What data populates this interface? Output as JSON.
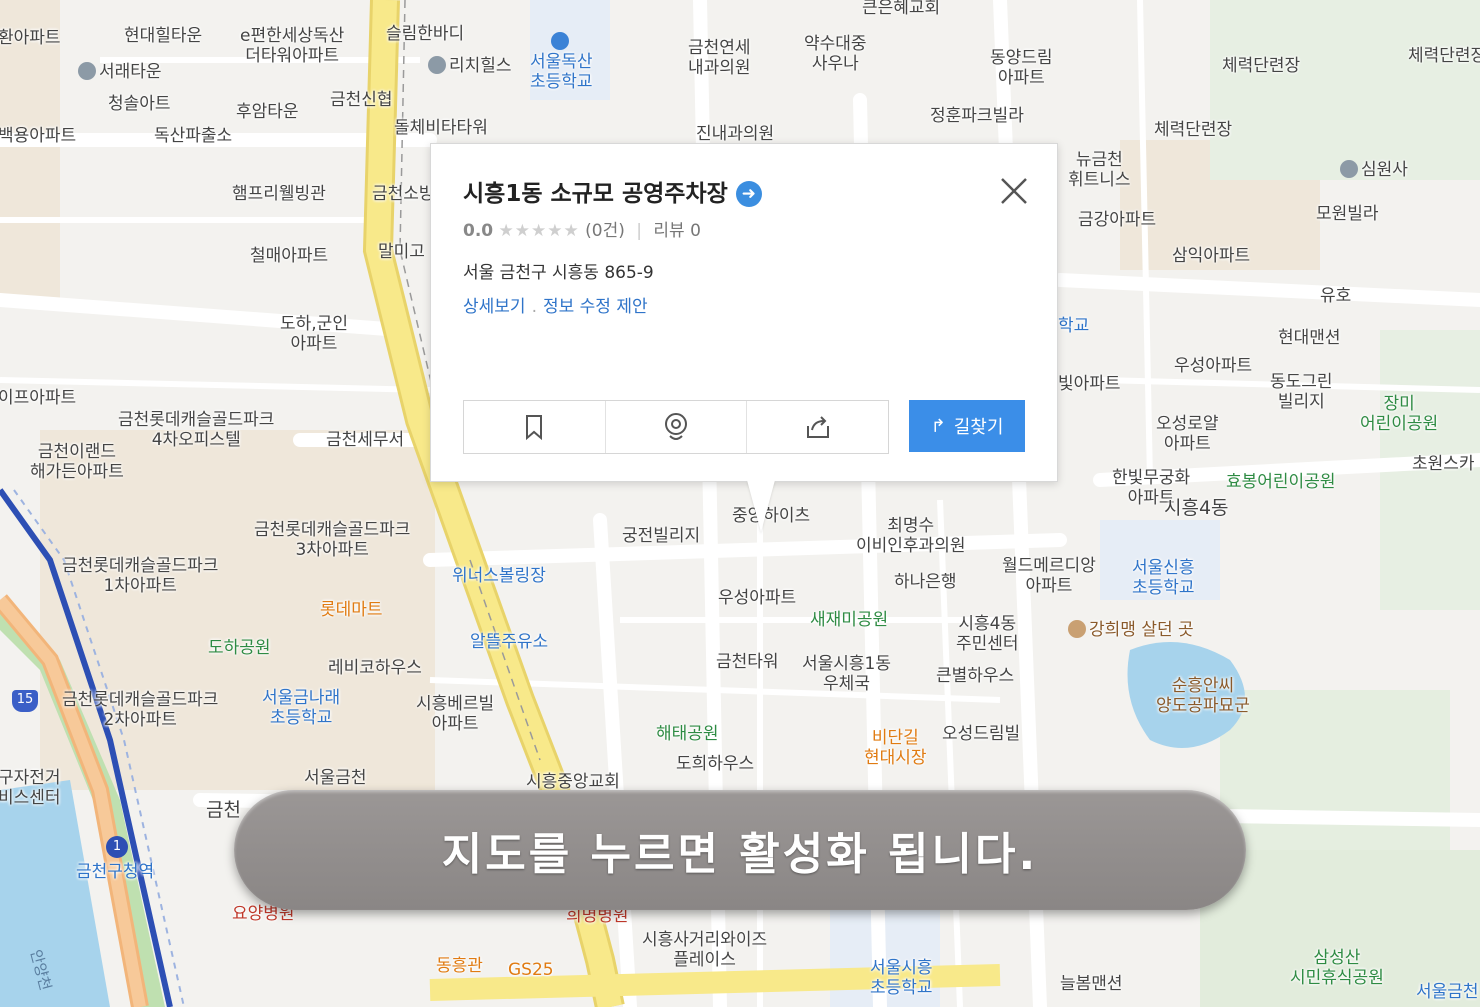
{
  "map": {
    "labels": [
      {
        "text": "환아파트",
        "pin": "apt"
      },
      {
        "text": "현대힐타운",
        "pin": ""
      },
      {
        "text": "e편한세상독산\n더타워아파트",
        "pin": "apt"
      },
      {
        "text": "슬림한바디",
        "pin": "bld"
      },
      {
        "text": "서울독산\n초등학교",
        "pin": "school"
      },
      {
        "text": "금천연세\n내과의원",
        "pin": "hosp"
      },
      {
        "text": "약수대중\n사우나",
        "pin": "bld"
      },
      {
        "text": "큰은혜교회",
        "pin": ""
      },
      {
        "text": "동양드림\n아파트",
        "pin": "apt"
      },
      {
        "text": "체력단련장",
        "pin": "bld"
      },
      {
        "text": "체력단련장",
        "pin": "bld"
      },
      {
        "text": "서래타운",
        "pin": "bld"
      },
      {
        "text": "리치힐스",
        "pin": "bld"
      },
      {
        "text": "청솔아트",
        "pin": "apt"
      },
      {
        "text": "후암타운",
        "pin": ""
      },
      {
        "text": "금천신협",
        "pin": "bld"
      },
      {
        "text": "돌체비타타워",
        "pin": "bld"
      },
      {
        "text": "진내과의원",
        "pin": "hosp"
      },
      {
        "text": "정훈파크빌라",
        "pin": ""
      },
      {
        "text": "뉴금천\n휘트니스",
        "pin": ""
      },
      {
        "text": "체력단련장",
        "pin": "bld"
      },
      {
        "text": "백용아파트",
        "pin": "apt"
      },
      {
        "text": "독산파출소",
        "pin": "bld"
      },
      {
        "text": "심원사",
        "pin": "bld"
      },
      {
        "text": "햄프리웰빙관",
        "pin": "bld"
      },
      {
        "text": "금천소방",
        "pin": "bld"
      },
      {
        "text": "금강아파트",
        "pin": "apt"
      },
      {
        "text": "모원빌라",
        "pin": ""
      },
      {
        "text": "철매아파트",
        "pin": "apt"
      },
      {
        "text": "말미고",
        "pin": ""
      },
      {
        "text": "삼익아파트",
        "pin": "apt"
      },
      {
        "text": "유호",
        "pin": "apt"
      },
      {
        "text": "도하,군인\n아파트",
        "pin": "apt"
      },
      {
        "text": "학교",
        "pin": "school"
      },
      {
        "text": "현대맨션",
        "pin": ""
      },
      {
        "text": "이프아파트",
        "pin": ""
      },
      {
        "text": "빛아파트",
        "pin": "apt"
      },
      {
        "text": "우성아파트",
        "pin": "apt"
      },
      {
        "text": "동도그린\n빌리지",
        "pin": ""
      },
      {
        "text": "장미\n어린이공원",
        "pin": "park"
      },
      {
        "text": "금천롯데캐슬골드파크\n4차오피스텔",
        "pin": "bld"
      },
      {
        "text": "금천세무서",
        "pin": "bld"
      },
      {
        "text": "금천이랜드\n해가든아파트",
        "pin": "apt"
      },
      {
        "text": "오성로얄\n아파트",
        "pin": "apt"
      },
      {
        "text": "한빛무궁화\n아파트",
        "pin": "apt"
      },
      {
        "text": "효봉어린이공원",
        "pin": "park"
      },
      {
        "text": "초원스카",
        "pin": ""
      },
      {
        "text": "시흥4동",
        "pin": ""
      },
      {
        "text": "금천롯데캐슬골드파크\n3차아파트",
        "pin": "apt"
      },
      {
        "text": "중앙하이츠",
        "pin": ""
      },
      {
        "text": "최명수\n이비인후과의원",
        "pin": "hosp"
      },
      {
        "text": "궁전빌리지",
        "pin": ""
      },
      {
        "text": "월드메르디앙\n아파트",
        "pin": "apt"
      },
      {
        "text": "서울신흥\n초등학교",
        "pin": "school"
      },
      {
        "text": "금천롯데캐슬골드파크\n1차아파트",
        "pin": "apt"
      },
      {
        "text": "위너스볼링장",
        "pin": "school"
      },
      {
        "text": "롯데마트",
        "pin": "shop"
      },
      {
        "text": "우성아파트",
        "pin": "apt"
      },
      {
        "text": "새재미공원",
        "pin": "park"
      },
      {
        "text": "하나은행",
        "pin": "bld"
      },
      {
        "text": "시흥4동\n주민센터",
        "pin": ""
      },
      {
        "text": "강희맹 살던 곳",
        "pin": "apt"
      },
      {
        "text": "도하공원",
        "pin": "park"
      },
      {
        "text": "알뜰주유소",
        "pin": "bld"
      },
      {
        "text": "레비코하우스",
        "pin": "bld"
      },
      {
        "text": "금천타워",
        "pin": ""
      },
      {
        "text": "서울시흥1동\n우체국",
        "pin": "bld"
      },
      {
        "text": "큰별하우스",
        "pin": ""
      },
      {
        "text": "순흥안씨\n양도공파묘군",
        "pin": "apt"
      },
      {
        "text": "금천롯데캐슬골드파크\n2차아파트",
        "pin": "apt"
      },
      {
        "text": "서울금나래\n초등학교",
        "pin": "school"
      },
      {
        "text": "시흥베르빌\n아파트",
        "pin": "apt"
      },
      {
        "text": "비단길\n현대시장",
        "pin": "shop"
      },
      {
        "text": "해태공원",
        "pin": "park"
      },
      {
        "text": "오성드림빌",
        "pin": ""
      },
      {
        "text": "구자전거\n비스센터",
        "pin": ""
      },
      {
        "text": "서울금천",
        "pin": "bld"
      },
      {
        "text": "도희하우스",
        "pin": ""
      },
      {
        "text": "시흥중앙교회",
        "pin": "bld"
      },
      {
        "text": "금천구청역",
        "pin": "school"
      },
      {
        "text": "요양병원",
        "pin": ""
      },
      {
        "text": "희명병원",
        "pin": ""
      },
      {
        "text": "동흥관",
        "pin": "shop"
      },
      {
        "text": "GS25",
        "pin": "shop"
      },
      {
        "text": "시흥사거리와이즈\n플레이스",
        "pin": "bld"
      },
      {
        "text": "서울시흥\n초등학교",
        "pin": "school"
      },
      {
        "text": "늘봄맨션",
        "pin": ""
      },
      {
        "text": "삼성산\n시민휴식공원",
        "pin": "park"
      },
      {
        "text": "서울금천",
        "pin": "school"
      },
      {
        "text": "금천",
        "pin": ""
      },
      {
        "text": "15",
        "pin": ""
      },
      {
        "text": "1",
        "pin": ""
      },
      {
        "text": "안양천",
        "pin": ""
      }
    ]
  },
  "popup": {
    "title": "시흥1동 소규모 공영주차장",
    "score": "0.0",
    "stars": "★★★★★",
    "review_count": "(0건)",
    "reviews": "리뷰 0",
    "address": "서울 금천구 시흥동 865-9",
    "link_detail": "상세보기",
    "link_suggest": "정보 수정 제안",
    "route_label": "길찾기",
    "actions": [
      "bookmark-icon",
      "location-pin-icon",
      "share-icon"
    ]
  },
  "banner": {
    "text": "지도를 누르면 활성화 됩니다."
  },
  "colors": {
    "accent": "#3b8ee8",
    "link": "#2f74c9",
    "road_main": "#f5e07a",
    "river": "#a7d3ec",
    "banner": "#8f8b8a"
  }
}
